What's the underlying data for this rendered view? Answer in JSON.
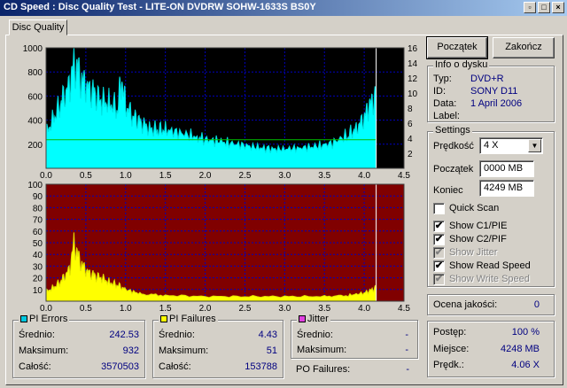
{
  "window": {
    "title": "CD Speed : Disc Quality Test - LITE-ON DVDRW SOHW-1633S BS0Y"
  },
  "tab": {
    "label": "Disc Quality"
  },
  "buttons": {
    "start": "Początek",
    "exit": "Zakończ"
  },
  "disc_info": {
    "title": "Info o dysku",
    "type_label": "Typ:",
    "type": "DVD+R",
    "id_label": "ID:",
    "id": "SONY D11",
    "date_label": "Data:",
    "date": "1 April 2006",
    "label_label": "Label:",
    "label": ""
  },
  "settings": {
    "title": "Settings",
    "speed_label": "Prędkość",
    "speed": "4 X",
    "start_label": "Początek",
    "start": "0000 MB",
    "end_label": "Koniec",
    "end": "4249 MB",
    "quick_scan": "Quick Scan",
    "show_c1": "Show C1/PIE",
    "show_c2": "Show C2/PIF",
    "show_jitter": "Show Jitter",
    "show_read": "Show Read Speed",
    "show_write": "Show Write Speed",
    "checked_mark": "✔"
  },
  "quality": {
    "label": "Ocena jakości:",
    "value": "0"
  },
  "progress": {
    "progress_label": "Postęp:",
    "progress_value": "100 %",
    "place_label": "Miejsce:",
    "place_value": "4248 MB",
    "speed_label": "Prędk.:",
    "speed_value": "4.06 X"
  },
  "pi_errors": {
    "title": "PI Errors",
    "color": "#00c8e0",
    "avg_label": "Średnio:",
    "avg": "242.53",
    "max_label": "Maksimum:",
    "max": "932",
    "total_label": "Całość:",
    "total": "3570503"
  },
  "pi_failures": {
    "title": "PI Failures",
    "color": "#ffff00",
    "avg_label": "Średnio:",
    "avg": "4.43",
    "max_label": "Maksimum:",
    "max": "51",
    "total_label": "Całość:",
    "total": "153788"
  },
  "jitter": {
    "title": "Jitter",
    "color": "#e040e0",
    "avg_label": "Średnio:",
    "avg": "-",
    "max_label": "Maksimum:",
    "max": "-",
    "po_label": "PO Failures:",
    "po": "-"
  },
  "chart_data": [
    {
      "type": "area",
      "name": "PI Errors",
      "xlim": [
        0,
        4.5
      ],
      "ylim": [
        0,
        1000
      ],
      "y2lim": [
        0,
        16
      ],
      "xticks": [
        "0.0",
        "0.5",
        "1.0",
        "1.5",
        "2.0",
        "2.5",
        "3.0",
        "3.5",
        "4.0",
        "4.5"
      ],
      "yticks": [
        "200",
        "400",
        "600",
        "800",
        "1000"
      ],
      "y2ticks": [
        "2",
        "4",
        "6",
        "8",
        "10",
        "12",
        "14",
        "16"
      ],
      "end_x": 4.15,
      "x": [
        0.0,
        0.1,
        0.2,
        0.3,
        0.35,
        0.4,
        0.45,
        0.5,
        0.6,
        0.7,
        0.8,
        0.9,
        0.95,
        1.0,
        1.1,
        1.2,
        1.3,
        1.4,
        1.5,
        1.7,
        1.9,
        2.0,
        2.2,
        2.4,
        2.6,
        2.8,
        3.0,
        3.2,
        3.4,
        3.6,
        3.8,
        3.9,
        4.0,
        4.05,
        4.1,
        4.15
      ],
      "values": [
        290,
        420,
        560,
        700,
        880,
        800,
        740,
        680,
        620,
        560,
        540,
        500,
        740,
        520,
        430,
        380,
        330,
        320,
        320,
        290,
        260,
        240,
        220,
        200,
        180,
        160,
        160,
        170,
        180,
        210,
        280,
        330,
        420,
        500,
        560,
        620
      ],
      "read_speed_level": 3.8,
      "series_color": "#00ffff",
      "speed_color": "#00c000"
    },
    {
      "type": "area",
      "name": "PI Failures",
      "xlim": [
        0,
        4.5
      ],
      "ylim": [
        0,
        100
      ],
      "xticks": [
        "0.0",
        "0.5",
        "1.0",
        "1.5",
        "2.0",
        "2.5",
        "3.0",
        "3.5",
        "4.0",
        "4.5"
      ],
      "yticks": [
        "10",
        "20",
        "30",
        "40",
        "50",
        "60",
        "70",
        "80",
        "90",
        "100"
      ],
      "end_x": 4.15,
      "x": [
        0.0,
        0.1,
        0.2,
        0.3,
        0.35,
        0.4,
        0.45,
        0.5,
        0.6,
        0.7,
        0.8,
        0.9,
        1.0,
        1.2,
        1.5,
        2.0,
        2.5,
        3.0,
        3.5,
        3.8,
        4.0,
        4.1,
        4.15
      ],
      "values": [
        8,
        12,
        18,
        28,
        50,
        38,
        32,
        26,
        22,
        20,
        16,
        14,
        10,
        6,
        5,
        4,
        4,
        4,
        4,
        5,
        7,
        10,
        12
      ],
      "series_color": "#ffff00"
    }
  ]
}
